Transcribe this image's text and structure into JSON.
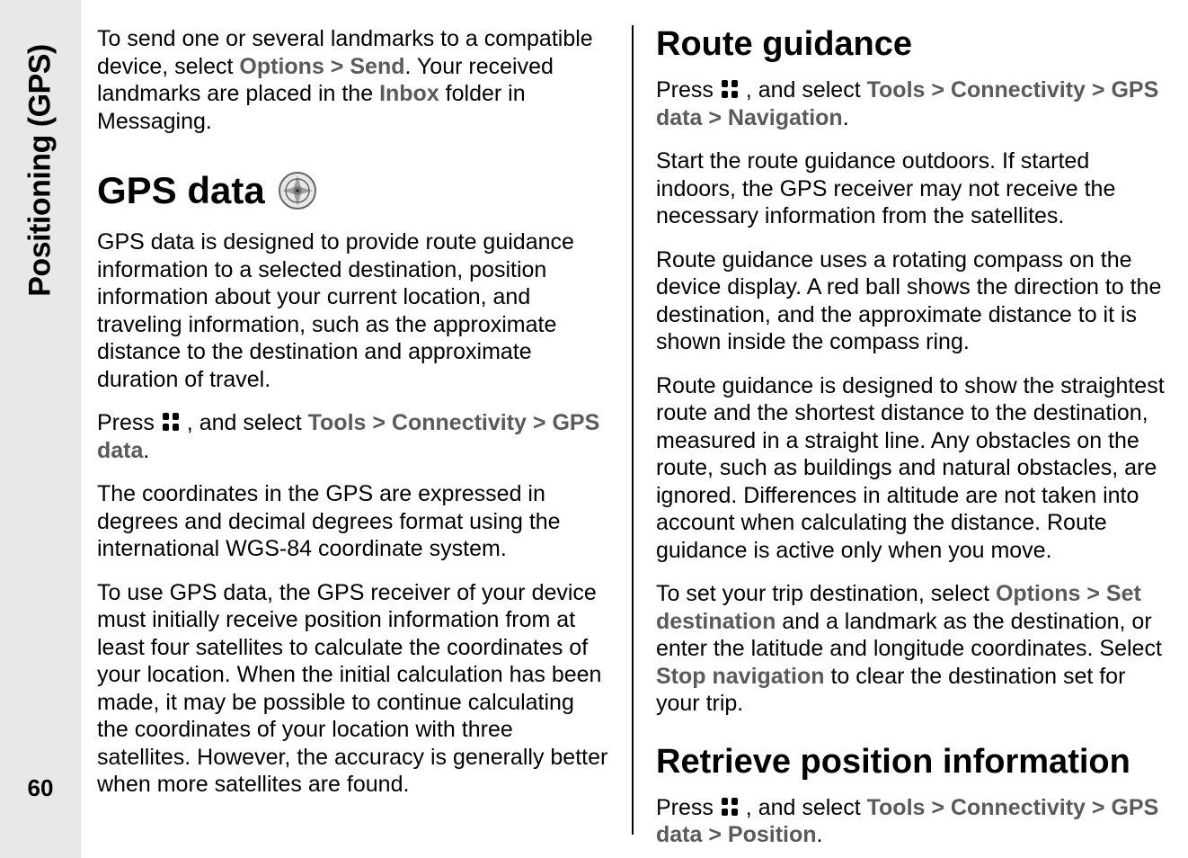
{
  "side_label": "Positioning (GPS)",
  "page_number": "60",
  "left": {
    "intro_part1": "To send one or several landmarks to a compatible device, select ",
    "intro_options": "Options",
    "intro_sep": " > ",
    "intro_send": "Send",
    "intro_part2": ". Your received landmarks are placed in the ",
    "intro_inbox": "Inbox",
    "intro_part3": " folder in Messaging.",
    "h1": "GPS data",
    "p1": "GPS data is designed to provide route guidance information to a selected destination, position information about your current location, and traveling information, such as the approximate distance to the destination and approximate duration of travel.",
    "press_lead": "Press ",
    "press_mid": " , and select ",
    "tools": "Tools",
    "connectivity": "Connectivity",
    "gpsdata": "GPS data",
    "press_end": ".",
    "p3": "The coordinates in the GPS are expressed in degrees and decimal degrees format using the international WGS-84 coordinate system.",
    "p4": "To use GPS data, the GPS receiver of your device must initially receive position information from at least four satellites to calculate the coordinates of your location. When the initial calculation has been made, it may be possible to continue calculating the coordinates of your location with three satellites. However, the accuracy is generally better when more satellites are found."
  },
  "right": {
    "h2a": "Route guidance",
    "pressA_lead": "Press ",
    "pressA_mid": " , and select ",
    "tools": "Tools",
    "connectivity": "Connectivity",
    "gpsdata": "GPS data",
    "navigation": "Navigation",
    "pressA_end": ".",
    "p1": "Start the route guidance outdoors. If started indoors, the GPS receiver may not receive the necessary information from the satellites.",
    "p2": "Route guidance uses a rotating compass on the device display. A red ball shows the direction to the destination, and the approximate distance to it is shown inside the compass ring.",
    "p3": "Route guidance is designed to show the straightest route and the shortest distance to the destination, measured in a straight line. Any obstacles on the route, such as buildings and natural obstacles, are ignored. Differences in altitude are not taken into account when calculating the distance. Route guidance is active only when you move.",
    "p4_a": "To set your trip destination, select ",
    "options": "Options",
    "sep": " > ",
    "set_dest": "Set destination",
    "p4_b": " and a landmark as the destination, or enter the latitude and longitude coordinates. Select ",
    "stop_nav": "Stop navigation",
    "p4_c": " to clear the destination set for your trip.",
    "h2b": "Retrieve position information",
    "position": "Position",
    "pressB_end": "."
  }
}
